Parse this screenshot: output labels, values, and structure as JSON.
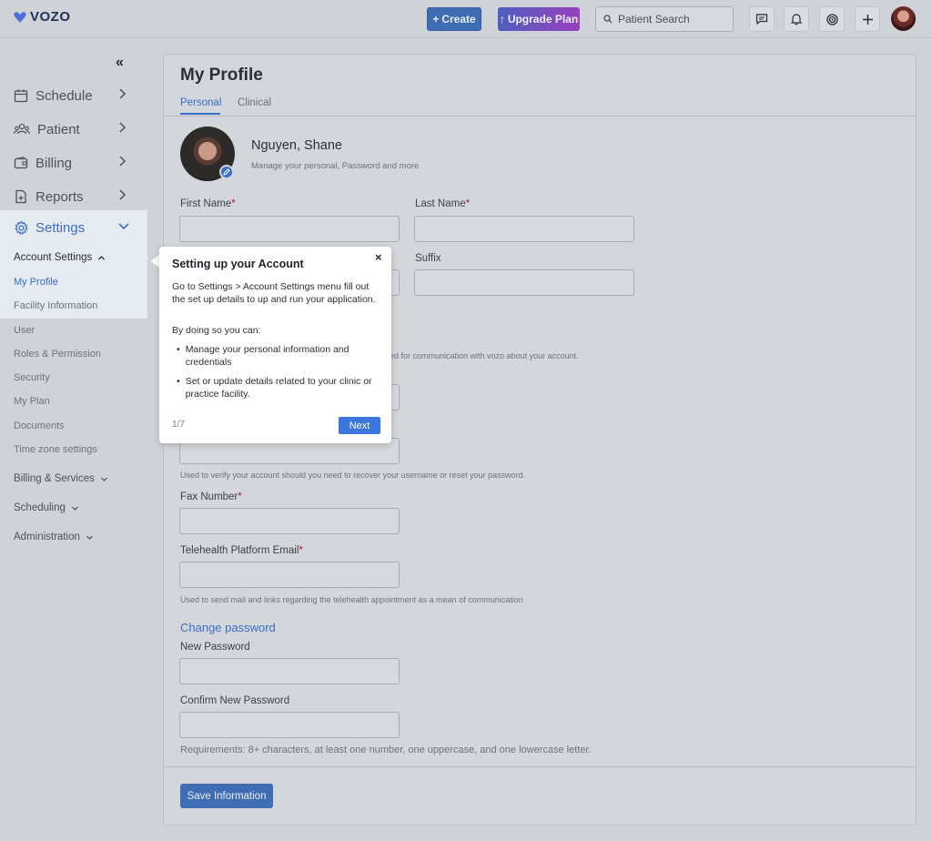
{
  "brand": {
    "name": "VOZO",
    "color": "#4a6fd8"
  },
  "topbar": {
    "create_label": "Create",
    "upgrade_label": "Upgrade Plan",
    "search_placeholder": "Patient Search",
    "icons": [
      "chat-icon",
      "bell-icon",
      "ai-icon",
      "plus-icon"
    ]
  },
  "sidebar": {
    "items": [
      {
        "label": "Schedule",
        "icon": "calendar-icon"
      },
      {
        "label": "Patient",
        "icon": "people-icon"
      },
      {
        "label": "Billing",
        "icon": "wallet-icon"
      },
      {
        "label": "Reports",
        "icon": "report-icon"
      },
      {
        "label": "Settings",
        "icon": "gear-icon"
      }
    ],
    "account_settings": {
      "label": "Account Settings",
      "links": [
        "My Profile",
        "Facility Information",
        "User",
        "Roles & Permission",
        "Security",
        "My Plan",
        "Documents",
        "Time zone settings"
      ]
    },
    "groups": [
      "Billing & Services",
      "Scheduling",
      "Administration"
    ]
  },
  "page": {
    "title": "My Profile",
    "tabs": [
      "Personal",
      "Clinical"
    ],
    "profile_name": "Nguyen, Shane",
    "profile_sub": "Manage your personal, Password and more"
  },
  "form": {
    "first_name": "First Name",
    "last_name": "Last Name",
    "suffix": "Suffix",
    "email_hint_partial": "ed for communication with vozo about your account.",
    "recovery_hint": "Used to verify your account should you need to recover your username or reset your password.",
    "fax_label": "Fax Number",
    "telehealth_label": "Telehealth Platform Email",
    "telehealth_hint": "Used to send mail and links regarding the telehealth appointment as a mean of communication",
    "change_password_title": "Change password",
    "new_password": "New Password",
    "confirm_password": "Confirm New Password",
    "requirements": "Requirements: 8+ characters, at least one number, one uppercase, and one lowercase letter.",
    "save_label": "Save Information",
    "required_mark": "*"
  },
  "tooltip": {
    "title": "Setting up your Account",
    "body": "Go to Settings > Account Settings menu fill out the set up details to up and run your application.",
    "intro": "By doing so you can:",
    "bullets": [
      "Manage your personal information and credentials",
      "Set or update details related to your clinic or practice facility."
    ],
    "step": "1/7",
    "next_label": "Next",
    "close_label": "×"
  },
  "colors": {
    "accent": "#3a6fc4",
    "required": "#a8203a"
  }
}
